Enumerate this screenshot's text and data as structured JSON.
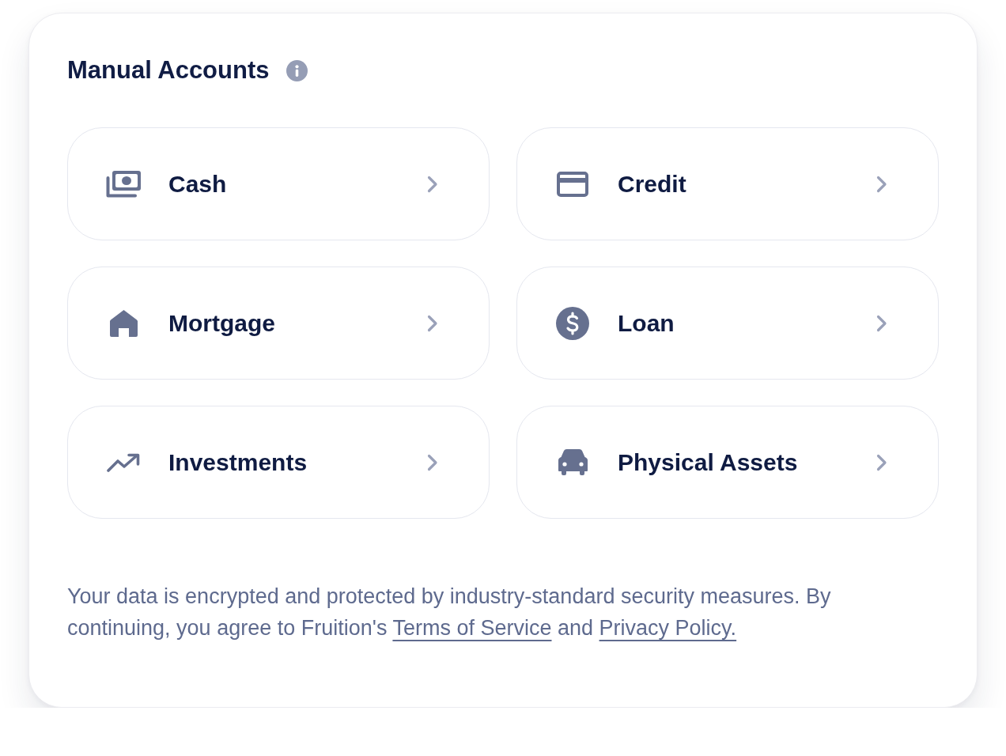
{
  "title": "Manual Accounts",
  "account_types": [
    {
      "label": "Cash",
      "kind": "cash"
    },
    {
      "label": "Credit",
      "kind": "credit"
    },
    {
      "label": "Mortgage",
      "kind": "mortgage"
    },
    {
      "label": "Loan",
      "kind": "loan"
    },
    {
      "label": "Investments",
      "kind": "investments"
    },
    {
      "label": "Physical Assets",
      "kind": "assets"
    }
  ],
  "disclaimer": {
    "parts": [
      {
        "kind": "text",
        "text": "Your data is encrypted and protected by industry-standard security measures. By continuing, you agree to Fruition's"
      },
      {
        "kind": "link",
        "text": "Terms of Service"
      },
      {
        "kind": "text",
        "text": "and"
      },
      {
        "kind": "link",
        "text": "Privacy Policy."
      }
    ]
  }
}
